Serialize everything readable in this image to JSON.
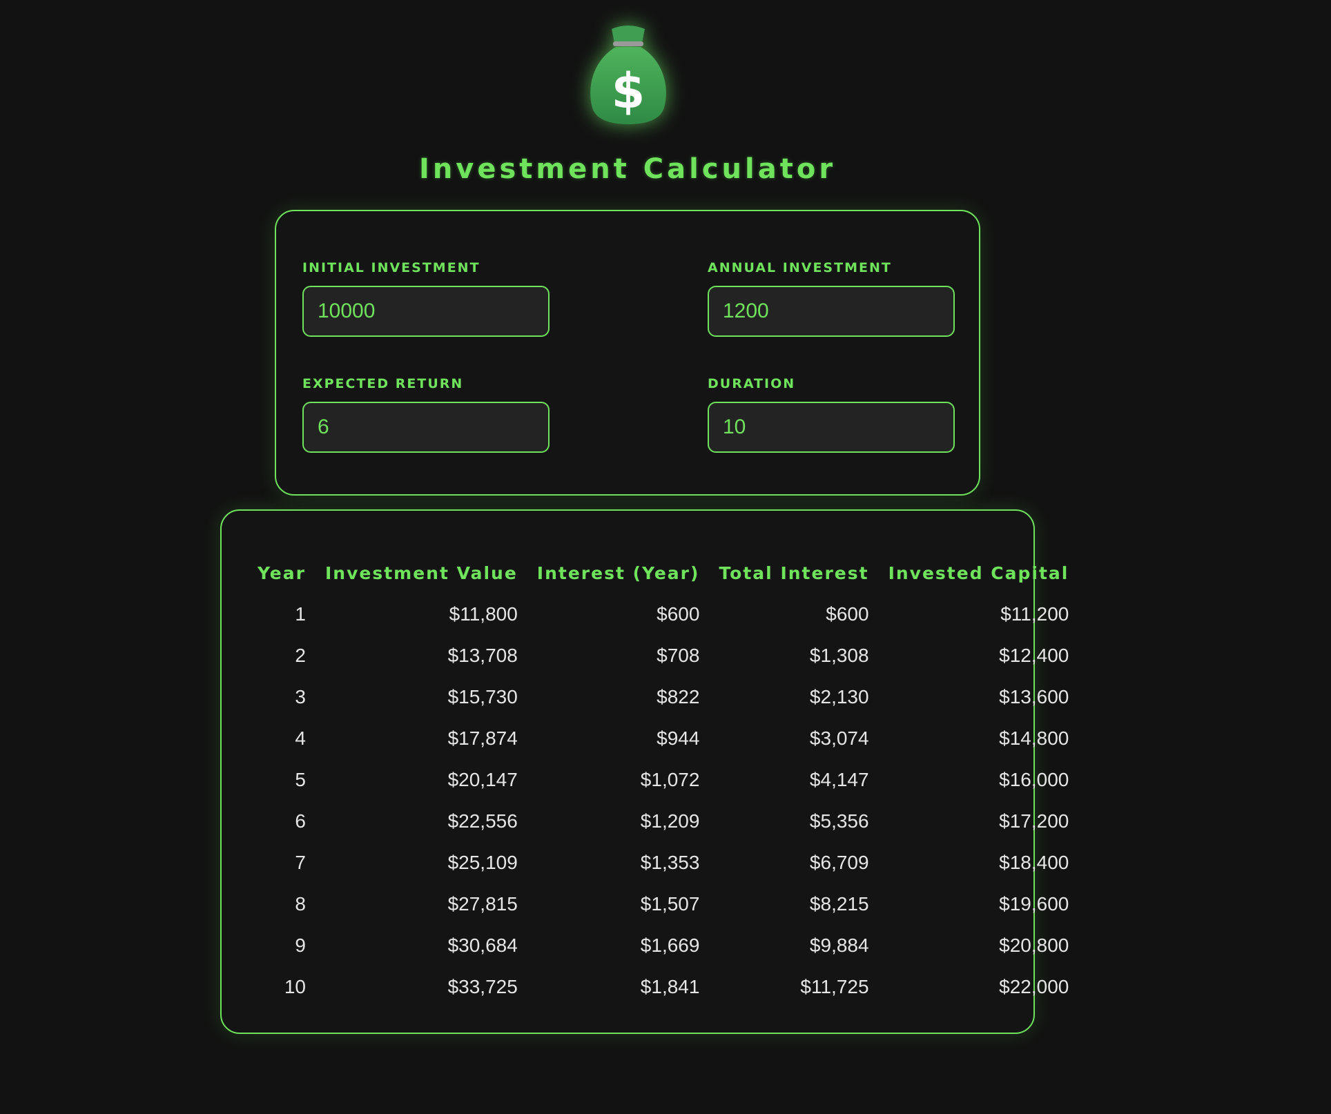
{
  "app": {
    "logo_icon": "money-bag-icon",
    "title": "Investment Calculator",
    "accent_color": "#6fe35c",
    "background_color": "#121212"
  },
  "inputs": {
    "initial_investment": {
      "label": "INITIAL INVESTMENT",
      "value": "10000"
    },
    "annual_investment": {
      "label": "ANNUAL INVESTMENT",
      "value": "1200"
    },
    "expected_return": {
      "label": "EXPECTED RETURN",
      "value": "6"
    },
    "duration": {
      "label": "DURATION",
      "value": "10"
    }
  },
  "results": {
    "headers": [
      "Year",
      "Investment Value",
      "Interest (Year)",
      "Total Interest",
      "Invested Capital"
    ],
    "rows": [
      [
        "1",
        "$11,800",
        "$600",
        "$600",
        "$11,200"
      ],
      [
        "2",
        "$13,708",
        "$708",
        "$1,308",
        "$12,400"
      ],
      [
        "3",
        "$15,730",
        "$822",
        "$2,130",
        "$13,600"
      ],
      [
        "4",
        "$17,874",
        "$944",
        "$3,074",
        "$14,800"
      ],
      [
        "5",
        "$20,147",
        "$1,072",
        "$4,147",
        "$16,000"
      ],
      [
        "6",
        "$22,556",
        "$1,209",
        "$5,356",
        "$17,200"
      ],
      [
        "7",
        "$25,109",
        "$1,353",
        "$6,709",
        "$18,400"
      ],
      [
        "8",
        "$27,815",
        "$1,507",
        "$8,215",
        "$19,600"
      ],
      [
        "9",
        "$30,684",
        "$1,669",
        "$9,884",
        "$20,800"
      ],
      [
        "10",
        "$33,725",
        "$1,841",
        "$11,725",
        "$22,000"
      ]
    ]
  }
}
